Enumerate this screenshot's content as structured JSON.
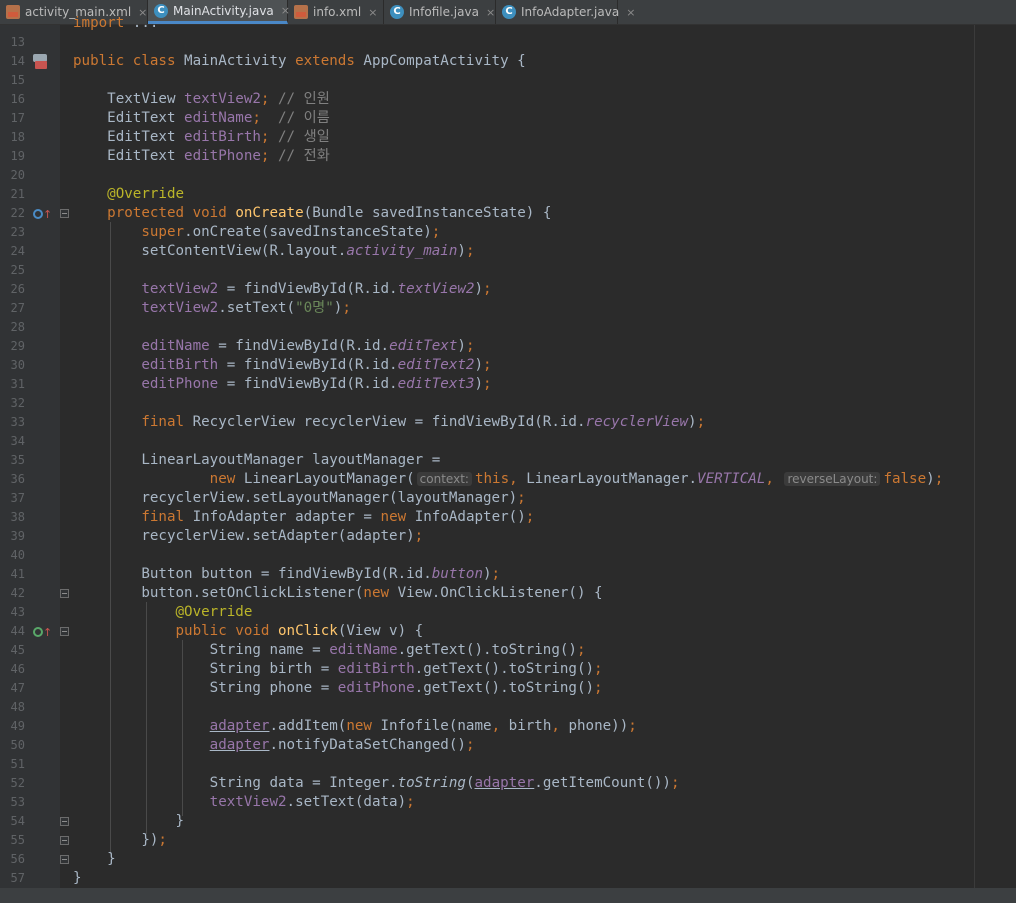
{
  "tabs": [
    {
      "label": "activity_main.xml",
      "type": "xml",
      "active": false
    },
    {
      "label": "MainActivity.java",
      "type": "java",
      "active": true
    },
    {
      "label": "info.xml",
      "type": "xml",
      "active": false
    },
    {
      "label": "Infofile.java",
      "type": "java",
      "active": false
    },
    {
      "label": "InfoAdapter.java",
      "type": "java",
      "active": false
    }
  ],
  "close_glyph": "×",
  "editor": {
    "lines": [
      {
        "n": "",
        "code": "<span class=\"kw\">import</span> ..."
      },
      {
        "n": "13",
        "code": ""
      },
      {
        "n": "14",
        "code": "<span class=\"kw\">public class</span> MainActivity <span class=\"kw\">extends</span> AppCompatActivity {",
        "icon": "class"
      },
      {
        "n": "15",
        "code": ""
      },
      {
        "n": "16",
        "code": "    TextView <span class=\"fld\">textView2</span><span class=\"kw\">;</span> <span class=\"cmt\">// 인원</span>"
      },
      {
        "n": "17",
        "code": "    EditText <span class=\"fld\">editName</span><span class=\"kw\">;</span>  <span class=\"cmt\">// 이름</span>"
      },
      {
        "n": "18",
        "code": "    EditText <span class=\"fld\">editBirth</span><span class=\"kw\">;</span> <span class=\"cmt\">// 생일</span>"
      },
      {
        "n": "19",
        "code": "    EditText <span class=\"fld\">editPhone</span><span class=\"kw\">;</span> <span class=\"cmt\">// 전화</span>"
      },
      {
        "n": "20",
        "code": ""
      },
      {
        "n": "21",
        "code": "    <span class=\"ann\">@Override</span>"
      },
      {
        "n": "22",
        "code": "    <span class=\"kw\">protected void</span> <span class=\"mth\">onCreate</span>(Bundle savedInstanceState) {",
        "icon": "override",
        "fold": true
      },
      {
        "n": "23",
        "code": "        <span class=\"kw\">super</span>.onCreate(savedInstanceState)<span class=\"kw\">;</span>"
      },
      {
        "n": "24",
        "code": "        setContentView(R.layout.<span class=\"sfld\">activity_main</span>)<span class=\"kw\">;</span>"
      },
      {
        "n": "25",
        "code": ""
      },
      {
        "n": "26",
        "code": "        <span class=\"fld\">textView2</span> = findViewById(R.id.<span class=\"sfld\">textView2</span>)<span class=\"kw\">;</span>"
      },
      {
        "n": "27",
        "code": "        <span class=\"fld\">textView2</span>.setText(<span class=\"str\">\"0명\"</span>)<span class=\"kw\">;</span>"
      },
      {
        "n": "28",
        "code": ""
      },
      {
        "n": "29",
        "code": "        <span class=\"fld\">editName</span> = findViewById(R.id.<span class=\"sfld\">editText</span>)<span class=\"kw\">;</span>"
      },
      {
        "n": "30",
        "code": "        <span class=\"fld\">editBirth</span> = findViewById(R.id.<span class=\"sfld\">editText2</span>)<span class=\"kw\">;</span>"
      },
      {
        "n": "31",
        "code": "        <span class=\"fld\">editPhone</span> = findViewById(R.id.<span class=\"sfld\">editText3</span>)<span class=\"kw\">;</span>"
      },
      {
        "n": "32",
        "code": ""
      },
      {
        "n": "33",
        "code": "        <span class=\"kw\">final</span> RecyclerView recyclerView = findViewById(R.id.<span class=\"sfld\">recyclerView</span>)<span class=\"kw\">;</span>"
      },
      {
        "n": "34",
        "code": ""
      },
      {
        "n": "35",
        "code": "        LinearLayoutManager layoutManager ="
      },
      {
        "n": "36",
        "code": "                <span class=\"kw\">new</span> LinearLayoutManager(<span class=\"hint\">context:</span><span class=\"kw\">this,</span> LinearLayoutManager.<span class=\"sfld\">VERTICAL</span><span class=\"kw\">,</span> <span class=\"hint\">reverseLayout:</span><span class=\"kw\">false</span>)<span class=\"kw\">;</span>"
      },
      {
        "n": "37",
        "code": "        recyclerView.setLayoutManager(layoutManager)<span class=\"kw\">;</span>"
      },
      {
        "n": "38",
        "code": "        <span class=\"kw\">final</span> InfoAdapter adapter = <span class=\"kw\">new</span> InfoAdapter()<span class=\"kw\">;</span>"
      },
      {
        "n": "39",
        "code": "        recyclerView.setAdapter(adapter)<span class=\"kw\">;</span>"
      },
      {
        "n": "40",
        "code": ""
      },
      {
        "n": "41",
        "code": "        Button button = findViewById(R.id.<span class=\"sfld\">button</span>)<span class=\"kw\">;</span>"
      },
      {
        "n": "42",
        "code": "        button.setOnClickListener(<span class=\"kw\">new</span> View.OnClickListener() {",
        "fold": true
      },
      {
        "n": "43",
        "code": "            <span class=\"ann\">@Override</span>"
      },
      {
        "n": "44",
        "code": "            <span class=\"kw\">public void</span> <span class=\"mth\">onClick</span>(View v) {",
        "icon": "impl",
        "fold": true
      },
      {
        "n": "45",
        "code": "                String name = <span class=\"fld\">editName</span>.getText().toString()<span class=\"kw\">;</span>"
      },
      {
        "n": "46",
        "code": "                String birth = <span class=\"fld\">editBirth</span>.getText().toString()<span class=\"kw\">;</span>"
      },
      {
        "n": "47",
        "code": "                String phone = <span class=\"fld\">editPhone</span>.getText().toString()<span class=\"kw\">;</span>"
      },
      {
        "n": "48",
        "code": ""
      },
      {
        "n": "49",
        "code": "                <span class=\"fld ul\">adapter</span>.addItem(<span class=\"kw\">new</span> Infofile(name<span class=\"kw\">,</span> birth<span class=\"kw\">,</span> phone))<span class=\"kw\">;</span>"
      },
      {
        "n": "50",
        "code": "                <span class=\"fld ul\">adapter</span>.notifyDataSetChanged()<span class=\"kw\">;</span>"
      },
      {
        "n": "51",
        "code": ""
      },
      {
        "n": "52",
        "code": "                String data = Integer.<span class=\"sm\">toString</span>(<span class=\"fld ul\">adapter</span>.getItemCount())<span class=\"kw\">;</span>"
      },
      {
        "n": "53",
        "code": "                <span class=\"fld\">textView2</span>.setText(data)<span class=\"kw\">;</span>"
      },
      {
        "n": "54",
        "code": "            }",
        "fold": true
      },
      {
        "n": "55",
        "code": "        })<span class=\"kw\">;</span>",
        "fold": true
      },
      {
        "n": "56",
        "code": "    }",
        "fold": true
      },
      {
        "n": "57",
        "code": "}"
      }
    ]
  }
}
